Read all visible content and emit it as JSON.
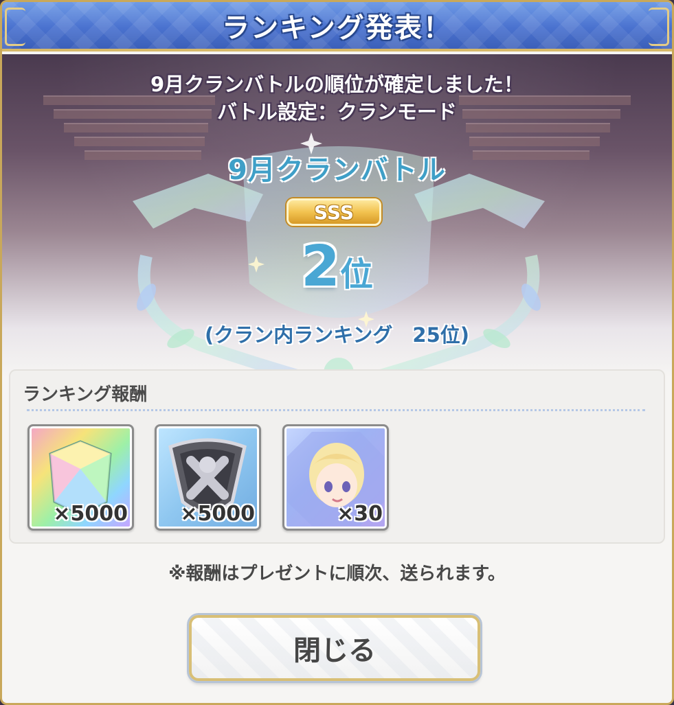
{
  "header": {
    "title": "ランキング発表！"
  },
  "announcement": {
    "line1": "9月クランバトルの順位が確定しました！",
    "line2": "バトル設定：クランモード"
  },
  "result": {
    "battle_name": "9月クランバトル",
    "rank_badge": "SSS",
    "rank_number": "2",
    "rank_suffix": "位",
    "clan_ranking": "(クラン内ランキング　25位)"
  },
  "rewards": {
    "heading": "ランキング報酬",
    "items": [
      {
        "icon": "rainbow-jewel-icon",
        "quantity": "×5000"
      },
      {
        "icon": "clan-coin-icon",
        "quantity": "×5000"
      },
      {
        "icon": "memory-piece-icon",
        "quantity": "×30"
      }
    ]
  },
  "note": "※報酬はプレゼントに順次、送られます。",
  "close_button": {
    "label": "閉じる"
  },
  "colors": {
    "header_blue": "#4a72cf",
    "gold_border": "#c9a85a",
    "rank_blue": "#4aa7d4",
    "badge_gold": "#f2c24f"
  }
}
